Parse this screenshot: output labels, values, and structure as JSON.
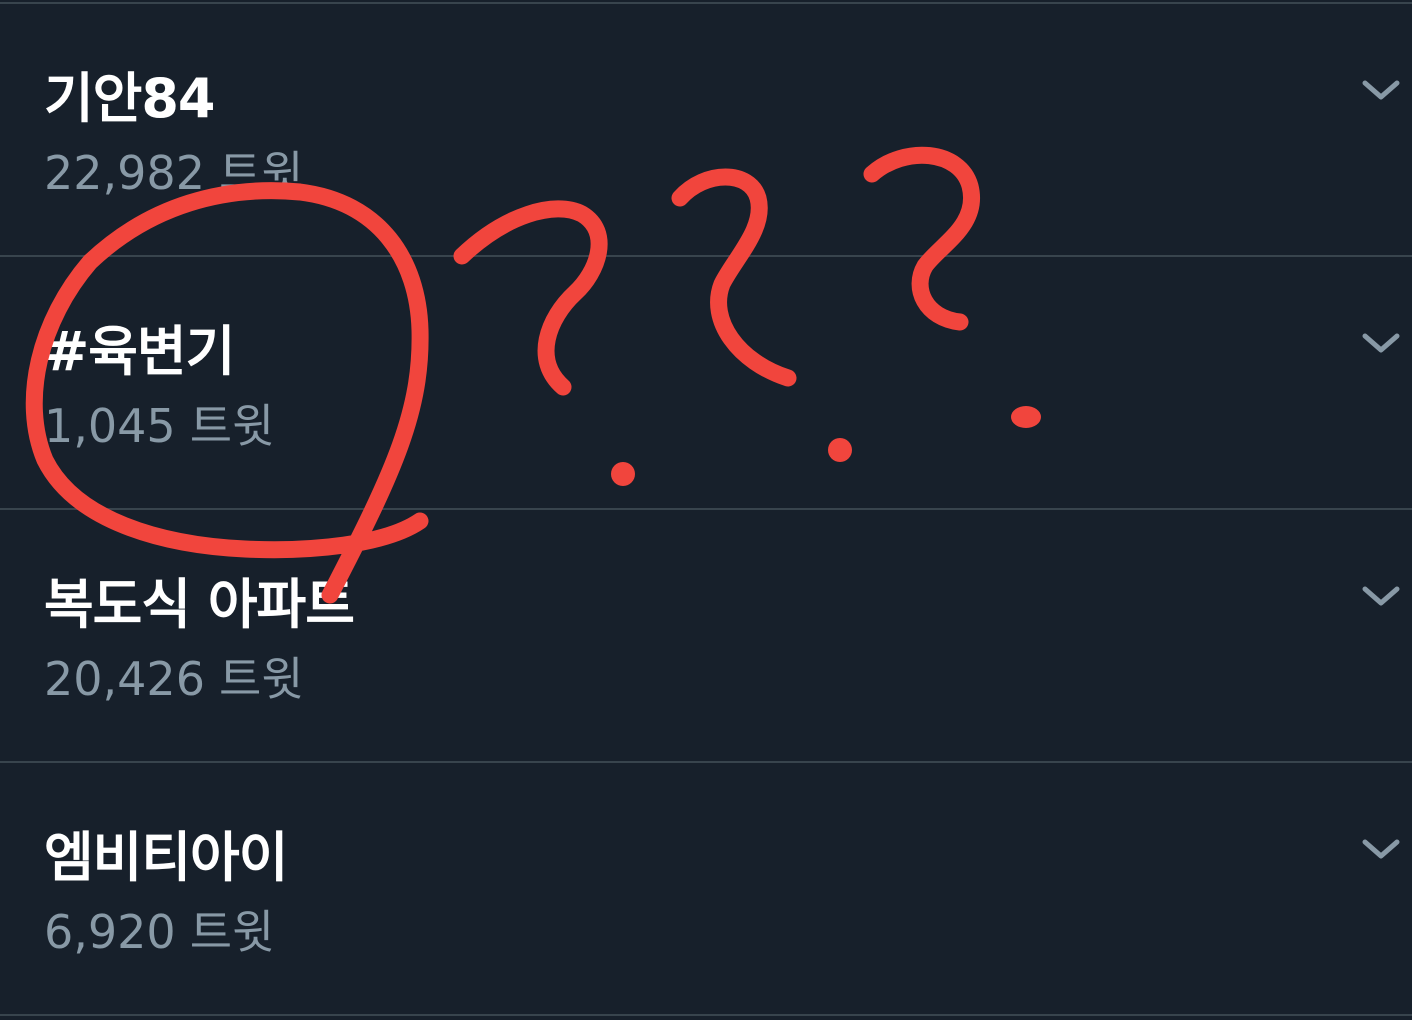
{
  "trends": [
    {
      "title": "기안84",
      "count": "22,982",
      "unit": "트윗"
    },
    {
      "title": "#육변기",
      "count": "1,045",
      "unit": "트윗"
    },
    {
      "title": "복도식 아파트",
      "count": "20,426",
      "unit": "트윗"
    },
    {
      "title": "엠비티아이",
      "count": "6,920",
      "unit": "트윗"
    }
  ],
  "colors": {
    "background": "#17202b",
    "title": "#ffffff",
    "count": "#8899a6",
    "divider": "#38444d",
    "chevron": "#8899a6",
    "annotation": "#f1453d"
  },
  "icons": {
    "row_menu": "chevron-down-icon"
  },
  "annotation": {
    "type": "hand-drawn red circle and three question marks"
  }
}
